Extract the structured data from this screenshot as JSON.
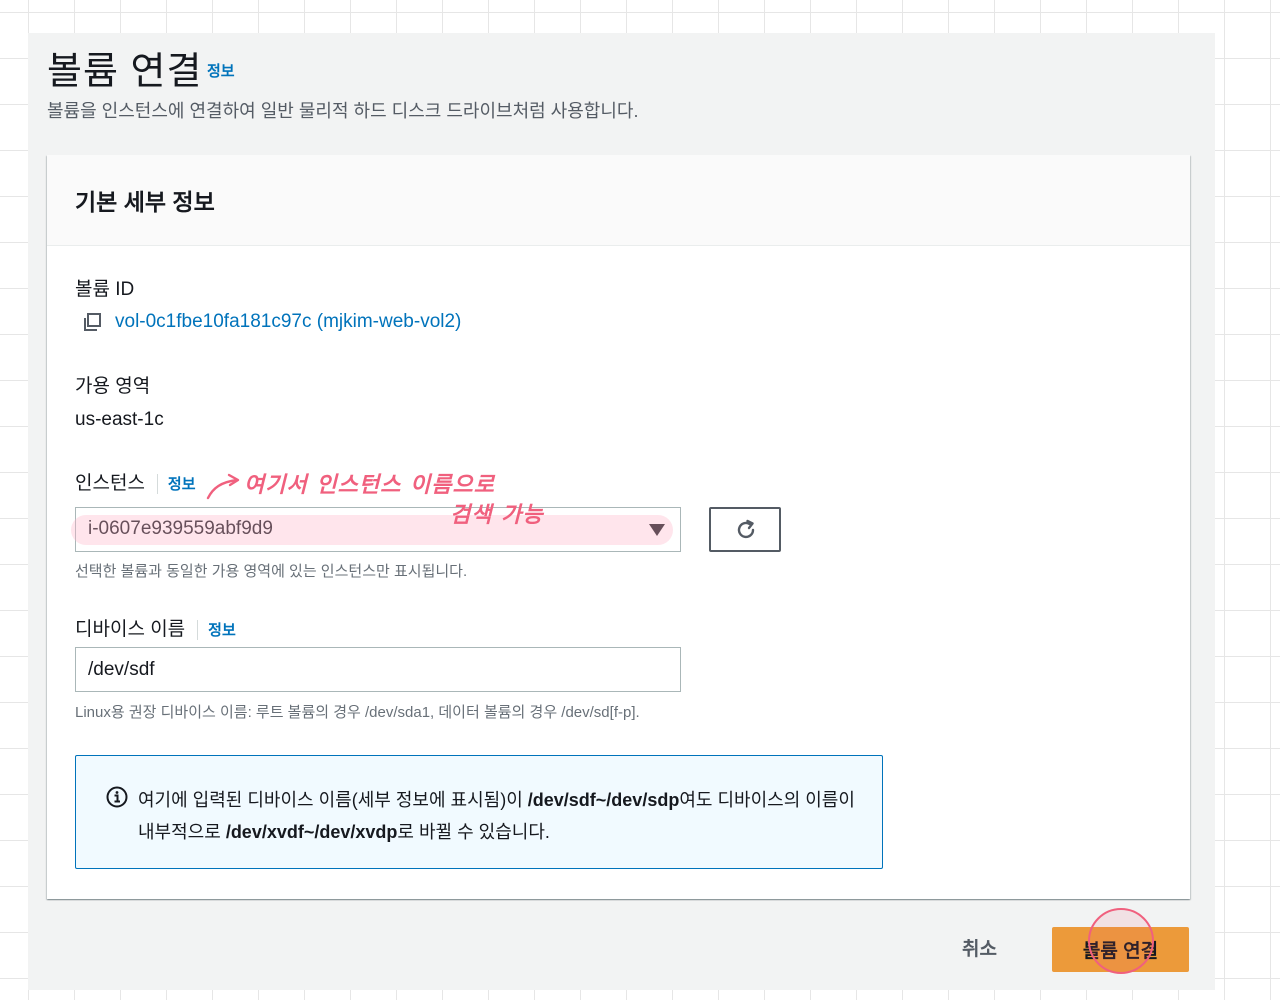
{
  "page": {
    "title": "볼륨 연결",
    "info_label": "정보",
    "description": "볼륨을 인스턴스에 연결하여 일반 물리적 하드 디스크 드라이브처럼 사용합니다."
  },
  "card": {
    "title": "기본 세부 정보",
    "volume_id": {
      "label": "볼륨 ID",
      "value": "vol-0c1fbe10fa181c97c (mjkim-web-vol2)"
    },
    "availability_zone": {
      "label": "가용 영역",
      "value": "us-east-1c"
    },
    "instance": {
      "label": "인스턴스",
      "info_label": "정보",
      "selected": "i-0607e939559abf9d9",
      "hint": "선택한 볼륨과 동일한 가용 영역에 있는 인스턴스만 표시됩니다."
    },
    "device_name": {
      "label": "디바이스 이름",
      "info_label": "정보",
      "value": "/dev/sdf",
      "hint": "Linux용 권장 디바이스 이름: 루트 볼륨의 경우 /dev/sda1, 데이터 볼륨의 경우 /dev/sd[f-p]."
    },
    "alert": {
      "text_1": "여기에 입력된 디바이스 이름(세부 정보에 표시됨)이 ",
      "bold_1": "/dev/sdf~/dev/sdp",
      "text_2": "여도 디바이스의 이름이 내부적으로 ",
      "bold_2": "/dev/xvdf~/dev/xvdp",
      "text_3": "로 바뀔 수 있습니다."
    }
  },
  "annotation": {
    "line_1": "여기서 인스턴스 이름으로",
    "line_2": "검색 가능",
    "color": "#f0607e"
  },
  "footer": {
    "cancel_label": "취소",
    "submit_label": "볼륨 연결"
  },
  "colors": {
    "link": "#0073bb",
    "primary_button": "#ec9a3a",
    "panel_background": "#f2f3f3"
  }
}
